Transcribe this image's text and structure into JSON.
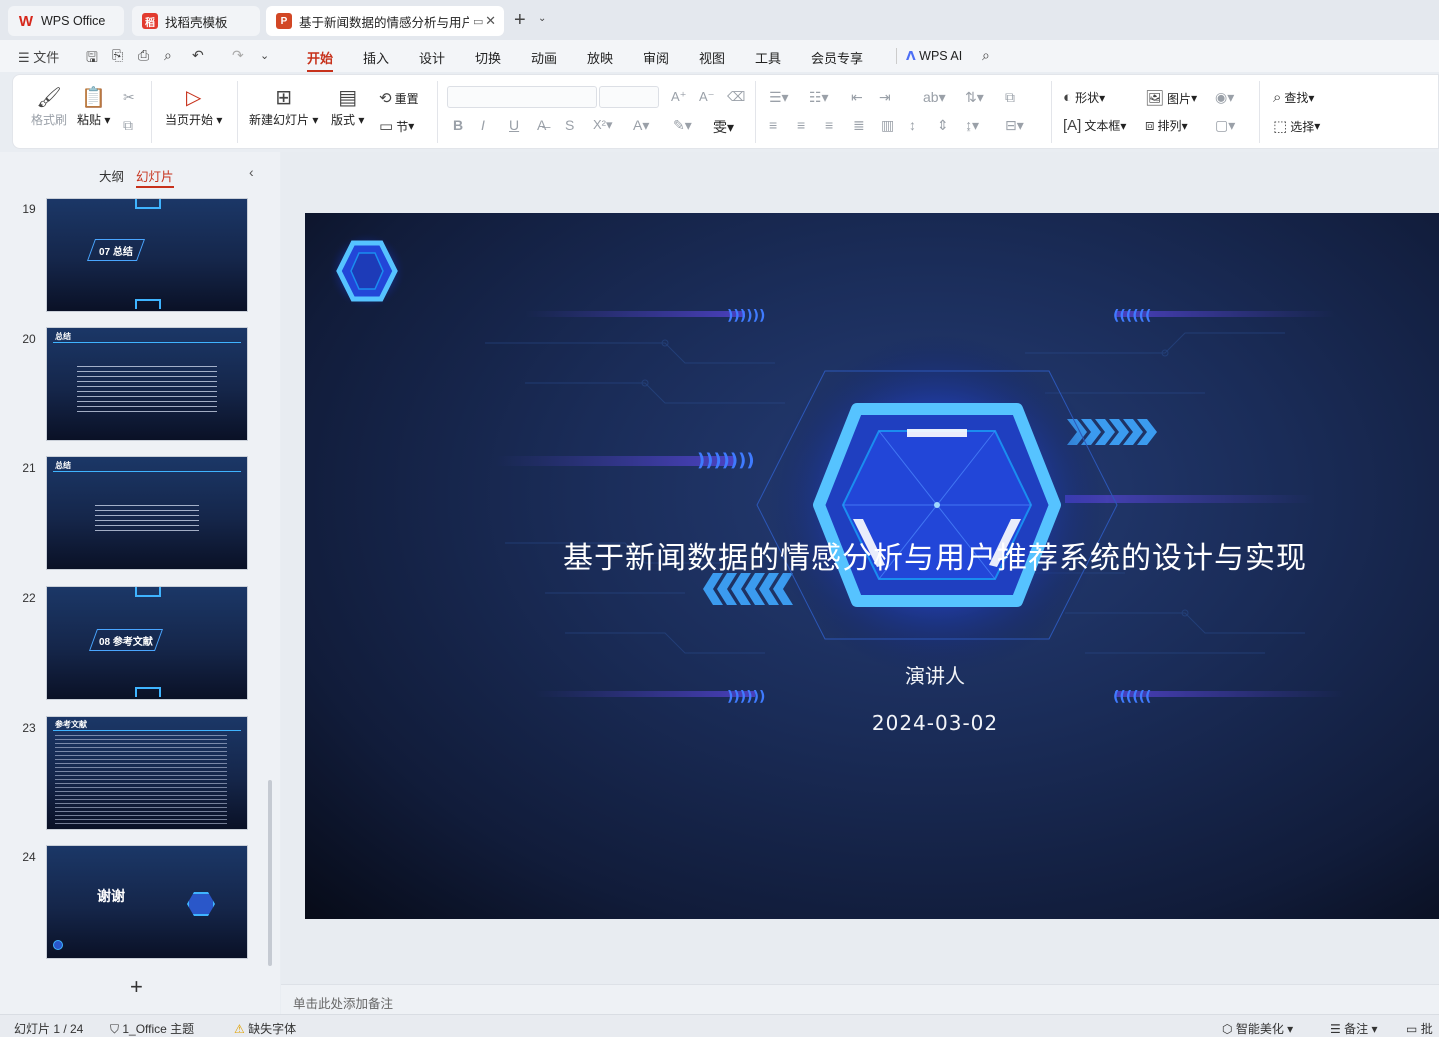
{
  "tabs": [
    {
      "label": "WPS Office",
      "icon": "wps-logo-icon"
    },
    {
      "label": "找稻壳模板",
      "icon": "docer-icon"
    },
    {
      "label": "基于新闻数据的情感分析与用户",
      "icon": "ppt-file-icon"
    }
  ],
  "menu": {
    "file": "文件",
    "items": [
      "开始",
      "插入",
      "设计",
      "切换",
      "动画",
      "放映",
      "审阅",
      "视图",
      "工具",
      "会员专享"
    ],
    "active": "开始",
    "wps_ai": "WPS AI"
  },
  "ribbon": {
    "format_painter": "格式刷",
    "paste": "粘贴",
    "start_from_current": "当页开始",
    "new_slide": "新建幻灯片",
    "layout": "版式",
    "reset": "重置",
    "section": "节",
    "shape": "形状",
    "picture": "图片",
    "find": "查找",
    "textbox": "文本框",
    "arrange": "排列",
    "select": "选择"
  },
  "left_panel": {
    "tab_outline": "大纲",
    "tab_slides": "幻灯片",
    "thumbs": [
      {
        "num": "19",
        "title": "07  总结"
      },
      {
        "num": "20",
        "title": "总结"
      },
      {
        "num": "21",
        "title": "总结"
      },
      {
        "num": "22",
        "title": "08  参考文献"
      },
      {
        "num": "23",
        "title": "参考文献"
      },
      {
        "num": "24",
        "title": "谢谢"
      }
    ],
    "add": "+"
  },
  "slide": {
    "title": "基于新闻数据的情感分析与用户推荐系统的设计与实现",
    "presenter": "演讲人",
    "date": "2024-03-02"
  },
  "notes_placeholder": "单击此处添加备注",
  "status": {
    "slide_count": "幻灯片 1 / 24",
    "theme": "1_Office 主题",
    "missing_font": "缺失字体",
    "smart_beautify": "智能美化",
    "notes": "备注",
    "comments": "批"
  },
  "colors": {
    "accent": "#c7311b",
    "slide_bg": "#1a2c58",
    "hex_glow": "#3fb4ff"
  }
}
